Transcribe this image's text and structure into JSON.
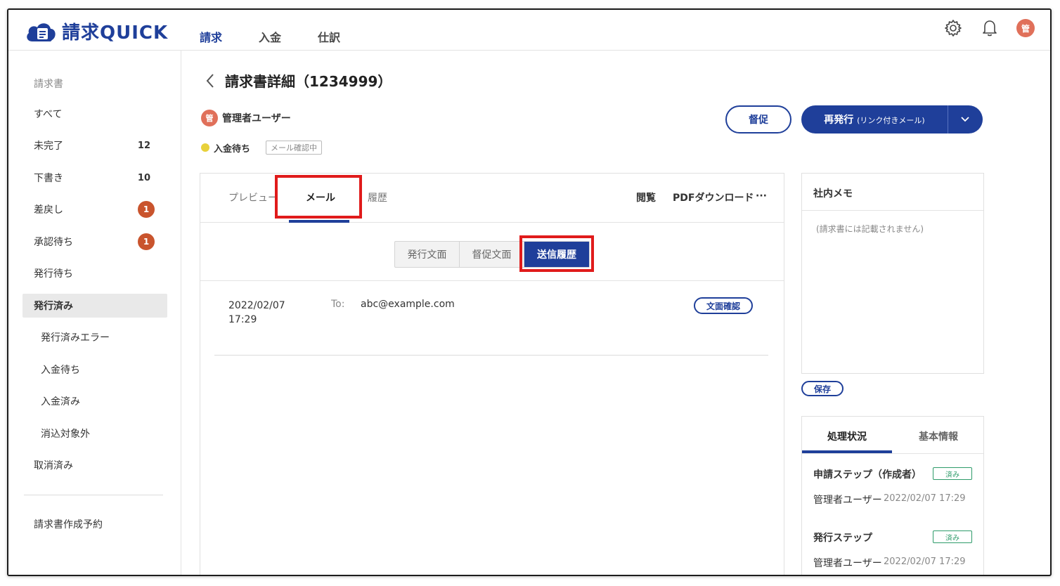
{
  "app": {
    "brand": "請求QUICK",
    "nav": [
      {
        "label": "請求"
      },
      {
        "label": "入金"
      },
      {
        "label": "仕訳"
      }
    ],
    "user_initial": "管"
  },
  "sidebar": {
    "section_title": "請求書",
    "items": [
      {
        "label": "すべて"
      },
      {
        "label": "未完了",
        "count": "12"
      },
      {
        "label": "下書き",
        "count": "10"
      },
      {
        "label": "差戻し",
        "badge": "1"
      },
      {
        "label": "承認待ち",
        "badge": "1"
      },
      {
        "label": "発行待ち"
      },
      {
        "label": "発行済み"
      },
      {
        "label": "発行済みエラー"
      },
      {
        "label": "入金待ち"
      },
      {
        "label": "入金済み"
      },
      {
        "label": "消込対象外"
      },
      {
        "label": "取消済み"
      }
    ],
    "footer_item": "請求書作成予約"
  },
  "page": {
    "title": "請求書詳細（1234999）",
    "owner_initial": "管",
    "owner_name": "管理者ユーザー",
    "status": "入金待ち",
    "status_tag": "メール確認中",
    "remind_button": "督促",
    "reissue_button": "再発行",
    "reissue_sub": "(リンク付きメール)"
  },
  "tabs": {
    "preview": "プレビュー",
    "mail": "メール",
    "history": "履歴",
    "view": "閲覧",
    "pdf": "PDFダウンロード",
    "more": "···"
  },
  "segment": {
    "issue_text": "発行文面",
    "remind_text": "督促文面",
    "send_history": "送信履歴"
  },
  "history": {
    "date": "2022/02/07",
    "time": "17:29",
    "to_label": "To:",
    "to_value": "abc@example.com",
    "check_button": "文面確認"
  },
  "memo": {
    "title": "社内メモ",
    "placeholder": "(請求書には記載されません)",
    "save_button": "保存"
  },
  "status_card": {
    "tab_active": "処理状況",
    "tab_other": "基本情報",
    "steps": [
      {
        "title": "申請ステップ（作成者）",
        "badge": "済み",
        "user": "管理者ユーザー",
        "time": "2022/02/07 17:29"
      },
      {
        "title": "発行ステップ",
        "badge": "済み",
        "user": "管理者ユーザー",
        "time": "2022/02/07 17:29"
      }
    ]
  },
  "colors": {
    "brand": "#1f3f9a",
    "highlight": "#e01b1b",
    "badge": "#c9542d",
    "done": "#2e9b6a"
  }
}
